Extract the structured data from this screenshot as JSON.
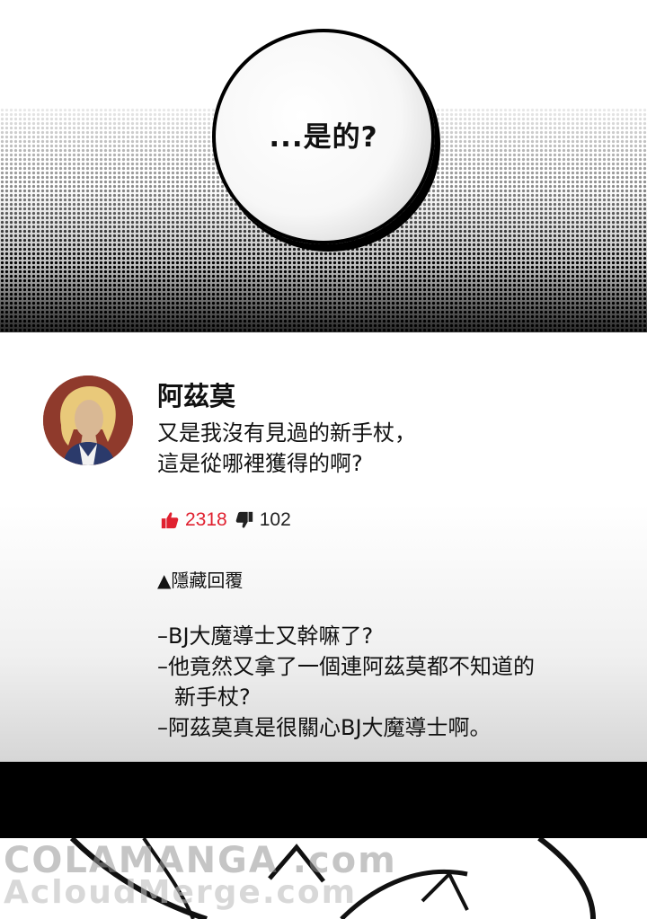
{
  "speech_bubble": {
    "text": "...是的?"
  },
  "comment": {
    "username": "阿茲莫",
    "lines": [
      "又是我沒有見過的新手杖，",
      "這是從哪裡獲得的啊?"
    ],
    "likes": "2318",
    "dislikes": "102",
    "like_color": "#e0202f",
    "hidden_replies_label": "▲隱藏回覆",
    "replies": [
      "–BJ大魔導士又幹嘛了?",
      "–他竟然又拿了一個連阿茲莫都不知道的",
      "新手杖?",
      "–阿茲莫真是很關心BJ大魔導士啊。"
    ]
  },
  "watermark": {
    "line1": "COLAMANGA .com",
    "line2": "AcloudMerge.com"
  },
  "icons": {
    "like": "thumbs-up-icon",
    "dislike": "thumbs-down-icon"
  }
}
